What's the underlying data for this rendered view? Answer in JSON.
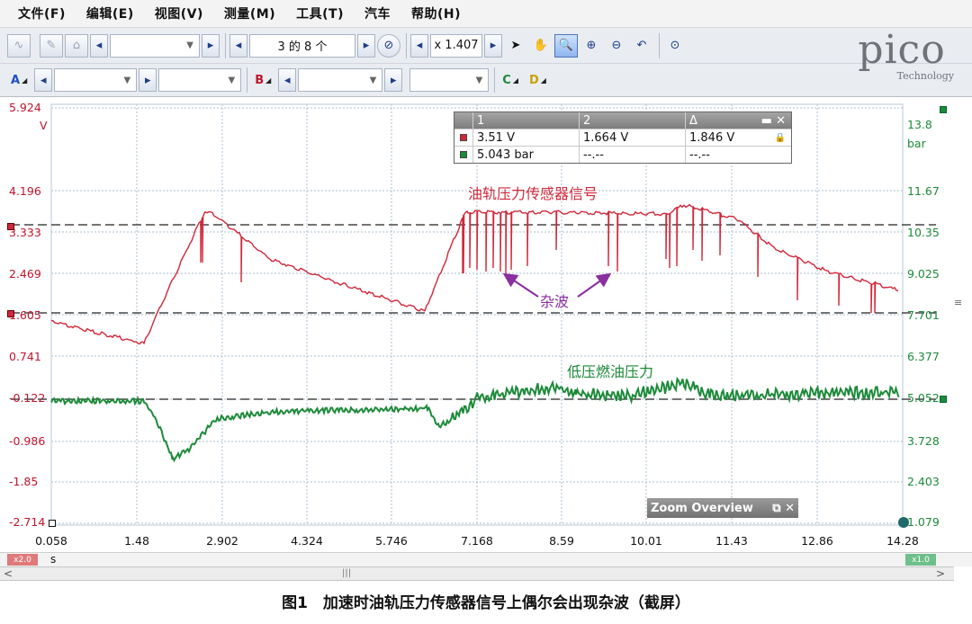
{
  "menu": [
    "文件(F)",
    "编辑(E)",
    "视图(V)",
    "测量(M)",
    "工具(T)",
    "汽车",
    "帮助(H)"
  ],
  "toolbar": {
    "buffer_label": "3 的 8 个",
    "zoom_label": "x 1.407"
  },
  "channels": {
    "a": "A",
    "b": "B",
    "c": "C",
    "d": "D"
  },
  "logo": {
    "name": "pico",
    "tagline": "Technology"
  },
  "axes": {
    "left_unit": "V",
    "right_unit": "bar",
    "left_ticks": [
      "5.924",
      "4.196",
      "3.333",
      "2.469",
      "1.605",
      "0.741",
      "-0.122",
      "-0.986",
      "-1.85",
      "-2.714"
    ],
    "right_ticks": [
      "13.8",
      "11.67",
      "10.35",
      "9.025",
      "7.701",
      "6.377",
      "5.052",
      "3.728",
      "2.403",
      "1.079"
    ],
    "x_ticks": [
      "0.058",
      "1.48",
      "2.902",
      "4.324",
      "5.746",
      "7.168",
      "8.59",
      "10.01",
      "11.43",
      "12.86",
      "14.28"
    ],
    "x_unit": "s"
  },
  "measurements": {
    "headers": [
      "1",
      "2",
      "Δ"
    ],
    "rows": [
      {
        "v1": "3.51 V",
        "v2": "1.664 V",
        "delta": "1.846 V",
        "color": "#c0142c"
      },
      {
        "v1": "5.043 bar",
        "v2": "--.--",
        "delta": "--.--",
        "color": "#1d8a3a"
      }
    ]
  },
  "annotations": {
    "red_signal": "油轨压力传感器信号",
    "noise": "杂波",
    "green_signal": "低压燃油压力"
  },
  "zoom_overview": {
    "label": "Zoom Overview"
  },
  "zoom_factors": {
    "left": "x2.0",
    "right": "x1.0"
  },
  "caption": "图1　加速时油轨压力传感器信号上偶尔会出现杂波（截屏）",
  "colors": {
    "red": "#d0283a",
    "green": "#1d8a3a",
    "grid": "#9fb4c8"
  }
}
